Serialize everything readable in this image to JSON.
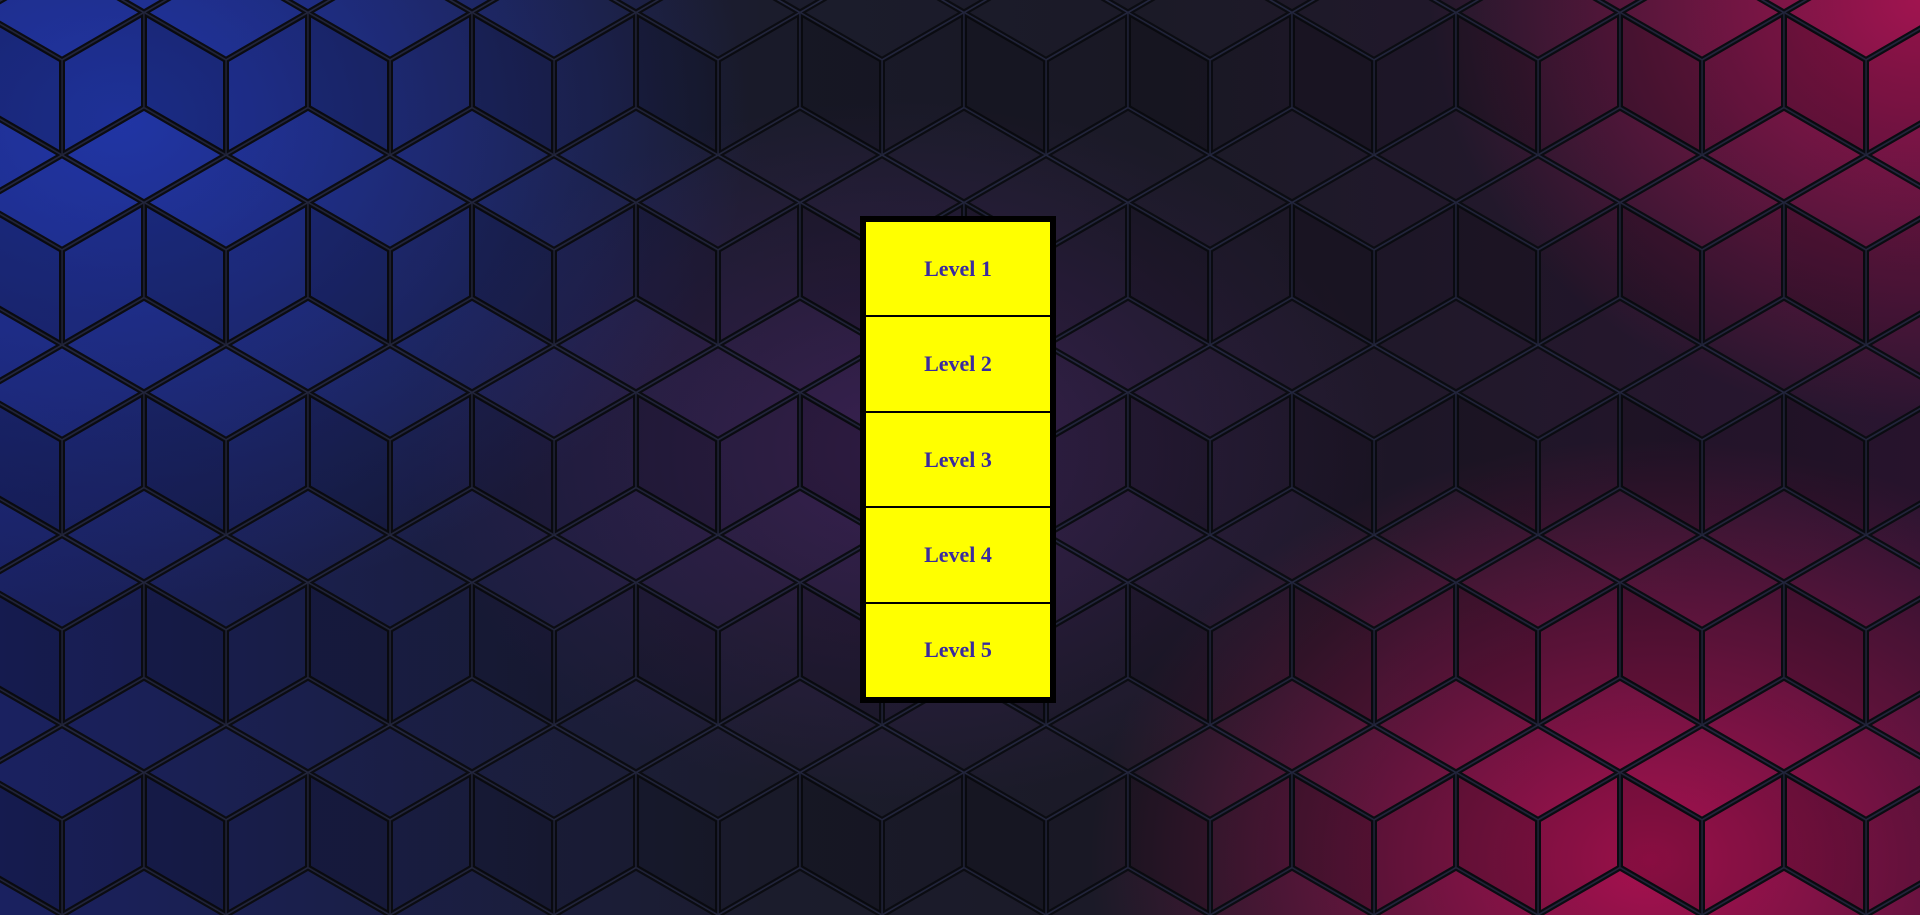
{
  "level_menu": {
    "levels": [
      {
        "label": "Level 1"
      },
      {
        "label": "Level 2"
      },
      {
        "label": "Level 3"
      },
      {
        "label": "Level 4"
      },
      {
        "label": "Level 5"
      }
    ]
  },
  "colors": {
    "button_fill": "#ffff00",
    "button_text": "#3a2aa0",
    "panel_border": "#000000",
    "background_left": "#1a2160",
    "background_right": "#c8145a"
  },
  "background": {
    "pattern": "isometric-cube-grid"
  }
}
